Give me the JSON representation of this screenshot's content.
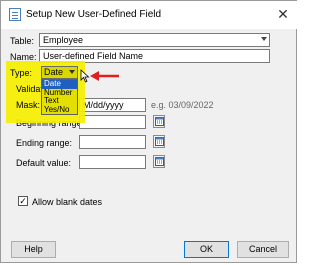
{
  "window": {
    "title": "Setup New User-Defined Field",
    "close_glyph": "✕"
  },
  "form": {
    "table_label": "Table:",
    "table_value": "Employee",
    "name_label": "Name:",
    "name_value": "User-defined Field Name",
    "type_label": "Type:",
    "type_value": "Date",
    "type_options": [
      "Date",
      "Number",
      "Text",
      "Yes/No"
    ],
    "type_selected_index": 0,
    "validation_label": "Validati",
    "mask_label": "Mask:",
    "mask_value": "M/dd/yyyy",
    "mask_example": "e.g. 03/09/2022",
    "beginning_range_label": "Beginning range:",
    "ending_range_label": "Ending range:",
    "default_value_label": "Default value:",
    "allow_blank_label": "Allow blank dates",
    "allow_blank_checked": true,
    "checkmark_glyph": "✓"
  },
  "buttons": {
    "help": "Help",
    "ok": "OK",
    "cancel": "Cancel"
  },
  "colors": {
    "highlight": "#f5ef00",
    "arrow": "#e02020",
    "selection": "#1e5fbf"
  }
}
